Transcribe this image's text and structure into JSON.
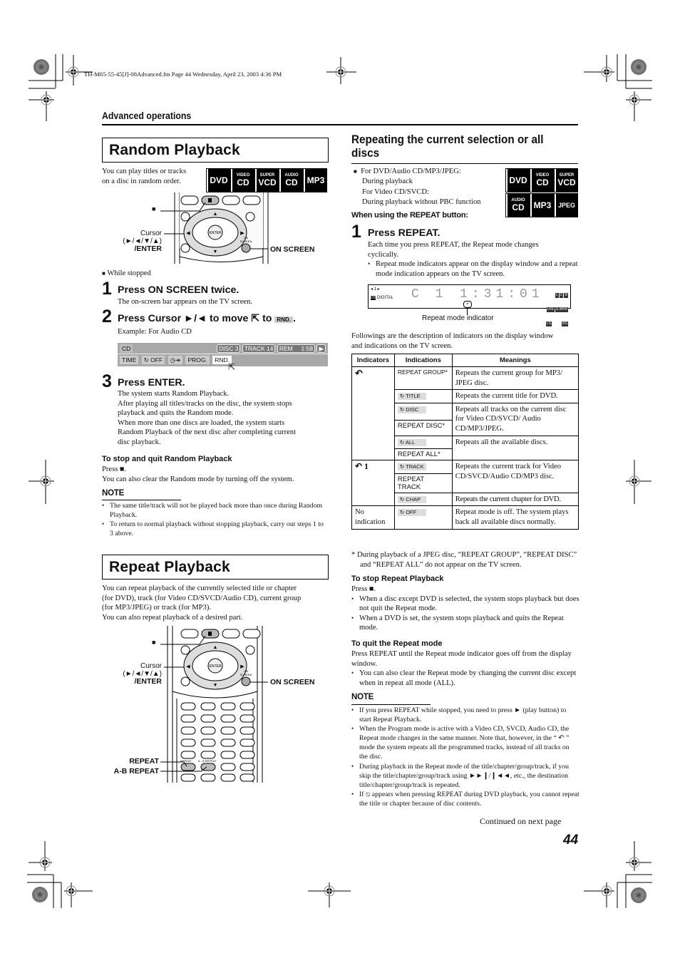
{
  "file_header": "TH-M65-55-45[J]-08Advanced.fm  Page 44  Wednesday, April 23, 2003  4:36 PM",
  "section_header": "Advanced operations",
  "random": {
    "title": "Random Playback",
    "intro": [
      "You can play titles or tracks",
      "on a disc in random order."
    ],
    "badges": [
      {
        "small": "",
        "main": "DVD"
      },
      {
        "small": "VIDEO",
        "main": "CD"
      },
      {
        "small": "SUPER",
        "main": "VCD"
      },
      {
        "small": "AUDIO",
        "main": "CD"
      },
      {
        "small": "",
        "main": "MP3"
      }
    ],
    "remote": {
      "stop_label": "■",
      "cursor_label": "Cursor",
      "cursor_arrows": "(►/◄/▼/▲)",
      "enter_label": "/ENTER",
      "on_screen_label": "ON SCREEN",
      "enter_key": "ENTER",
      "on_screen_key": "ON SCREEN"
    },
    "condition": "While stopped",
    "steps": [
      {
        "num": "1",
        "head": "Press ON SCREEN twice.",
        "body": [
          "The on-screen bar appears on the TV screen."
        ]
      },
      {
        "num": "2",
        "head": "Press Cursor ►/◄ to move",
        "head_to": "to",
        "head_target": "RND.",
        "body": [
          "Example: For Audio CD"
        ]
      },
      {
        "num": "3",
        "head": "Press ENTER.",
        "body": [
          "The system starts Random Playback.",
          "After playing all titles/tracks on the disc, the system stops",
          "playback and quits the Random mode.",
          "When more than one discs are loaded, the system starts",
          "Random Playback of the next disc after completing current",
          "disc playback."
        ]
      }
    ],
    "osd": {
      "source": "CD",
      "disc": "DISC 3",
      "track": "TRACK 14",
      "rem": "REM",
      "time": "1:58",
      "cells": [
        "TIME",
        "↻ OFF",
        "◷➔",
        "PROG.",
        "RND."
      ]
    },
    "stop_head": "To stop and quit Random Playback",
    "stop_body": [
      "Press ■.",
      "You can also clear the Random mode by turning off the system."
    ],
    "note_head": "NOTE",
    "notes": [
      "The same title/track will not be played back more than once during Random Playback.",
      "To return to normal playback without stopping playback, carry out steps 1 to 3 above."
    ]
  },
  "repeat": {
    "title": "Repeat Playback",
    "intro": [
      "You can repeat playback of the currently selected title or chapter",
      "(for DVD), track (for Video CD/SVCD/Audio CD), current group",
      "(for MP3/JPEG) or track (for MP3).",
      "You can also repeat playback of a desired part."
    ],
    "remote": {
      "stop_label": "■",
      "cursor_label": "Cursor",
      "cursor_arrows": "(►/◄/▼/▲)",
      "enter_label": "/ENTER",
      "on_screen_label": "ON SCREEN",
      "repeat_label": "REPEAT",
      "ab_repeat_label": "A-B REPEAT",
      "key_repeat": "REPEAT",
      "key_ab": "A - B REPEAT"
    }
  },
  "repeating": {
    "title": [
      "Repeating the current selection or all",
      "discs"
    ],
    "cond1": "For DVD/Audio CD/MP3/JPEG:",
    "cond1b": "During playback",
    "cond2": "For Video CD/SVCD:",
    "cond2b": "During playback without PBC function",
    "badges_top": [
      {
        "small": "",
        "main": "DVD"
      },
      {
        "small": "VIDEO",
        "main": "CD"
      },
      {
        "small": "SUPER",
        "main": "VCD"
      }
    ],
    "badges_bottom": [
      {
        "small": "AUDIO",
        "main": "CD"
      },
      {
        "small": "",
        "main": "MP3"
      },
      {
        "small": "",
        "main": "JPEG"
      }
    ],
    "when_head": "When using the REPEAT button:",
    "step1_num": "1",
    "step1_head": "Press REPEAT.",
    "step1_body": [
      "Each time you press REPEAT, the Repeat mode changes",
      "cyclically."
    ],
    "step1_bullet": "Repeat mode indicators appear on the display window and a repeat mode indication appears on the TV screen.",
    "display": {
      "top_left": "◂ 1 ▸",
      "digital": "DIGITAL",
      "chapter": "C  1",
      "time": "1:31:01",
      "speakers_row1": [
        "L",
        "C",
        "R"
      ],
      "speakers_row2": [
        "LFE",
        "S.WFR"
      ],
      "speakers_row3": [
        "LS",
        "RS"
      ],
      "indicator_caption": "Repeat mode indicator"
    },
    "table_intro": [
      "Followings are the description of indicators on the display window",
      "and indications on the TV screen."
    ],
    "table": {
      "headers": [
        "Indicators",
        "Indications",
        "Meanings"
      ],
      "groups": [
        {
          "indicator": "↶",
          "rows": [
            {
              "indications": [
                {
                  "text": "REPEAT GROUP*",
                  "chip": false
                }
              ],
              "meaning": "Repeats the current group for MP3/ JPEG disc."
            },
            {
              "indications": [
                {
                  "text": "↻ TITLE",
                  "chip": true
                }
              ],
              "meaning": "Repeats the current title for DVD."
            },
            {
              "indications": [
                {
                  "text": "↻ DISC",
                  "chip": true
                },
                {
                  "text": "REPEAT DISC*",
                  "chip": false
                }
              ],
              "meaning": "Repeats all tracks on the current disc for Video CD/SVCD/ Audio CD/MP3/JPEG."
            },
            {
              "indications": [
                {
                  "text": "↻ ALL",
                  "chip": true
                },
                {
                  "text": "REPEAT ALL*",
                  "chip": false
                }
              ],
              "meaning": "Repeats all the available discs."
            }
          ]
        },
        {
          "indicator": "↶ 1",
          "rows": [
            {
              "indications": [
                {
                  "text": "↻ TRACK",
                  "chip": true
                },
                {
                  "text": "REPEAT TRACK",
                  "chip": false
                }
              ],
              "meaning": "Repeats the current track for Video CD/SVCD/Audio CD/MP3 disc."
            },
            {
              "indications": [
                {
                  "text": "↻ CHAP",
                  "chip": true
                }
              ],
              "meaning": "Repeats the current chapter for DVD."
            }
          ]
        },
        {
          "indicator": "No indication",
          "rows": [
            {
              "indications": [
                {
                  "text": "↻ OFF",
                  "chip": true
                }
              ],
              "meaning": "Repeat mode is off. The system plays back all available discs normally."
            }
          ]
        }
      ]
    },
    "footnote": "*  During playback of a JPEG disc, “REPEAT GROUP”, “REPEAT DISC” and “REPEAT ALL” do not appear on the TV screen.",
    "stop_head": "To stop Repeat Playback",
    "stop_press": "Press ■.",
    "stop_bullets": [
      "When a disc except DVD is selected, the system stops playback but does not quit the Repeat mode.",
      "When a DVD is set, the system stops playback and quits the Repeat mode."
    ],
    "quit_head": "To quit the Repeat mode",
    "quit_body": "Press REPEAT until the Repeat mode indicator goes off from the display window.",
    "quit_bullets": [
      "You can also clear the Repeat mode by changing the current disc except when in repeat all mode (ALL)."
    ],
    "note_head": "NOTE",
    "notes": [
      "If you press REPEAT while stopped, you need to press ► (play button) to start Repeat Playback.",
      "When the Program mode is active with a Video CD, SVCD, Audio CD, the Repeat mode changes in the same manner. Note that, however, in the “ ↶ ” mode the system repeats all the programmed tracks, instead of all tracks on the disc.",
      "During playback in the Repeat mode of the title/chapter/group/track, if you skip the title/chapter/group/track using ►►❙/❙◄◄, etc., the destination title/chapter/group/track is repeated.",
      "If ⦸ appears when pressing REPEAT during DVD playback, you cannot repeat the title or chapter because of disc contents."
    ]
  },
  "footer": {
    "continued": "Continued on next page",
    "page_number": "44"
  }
}
